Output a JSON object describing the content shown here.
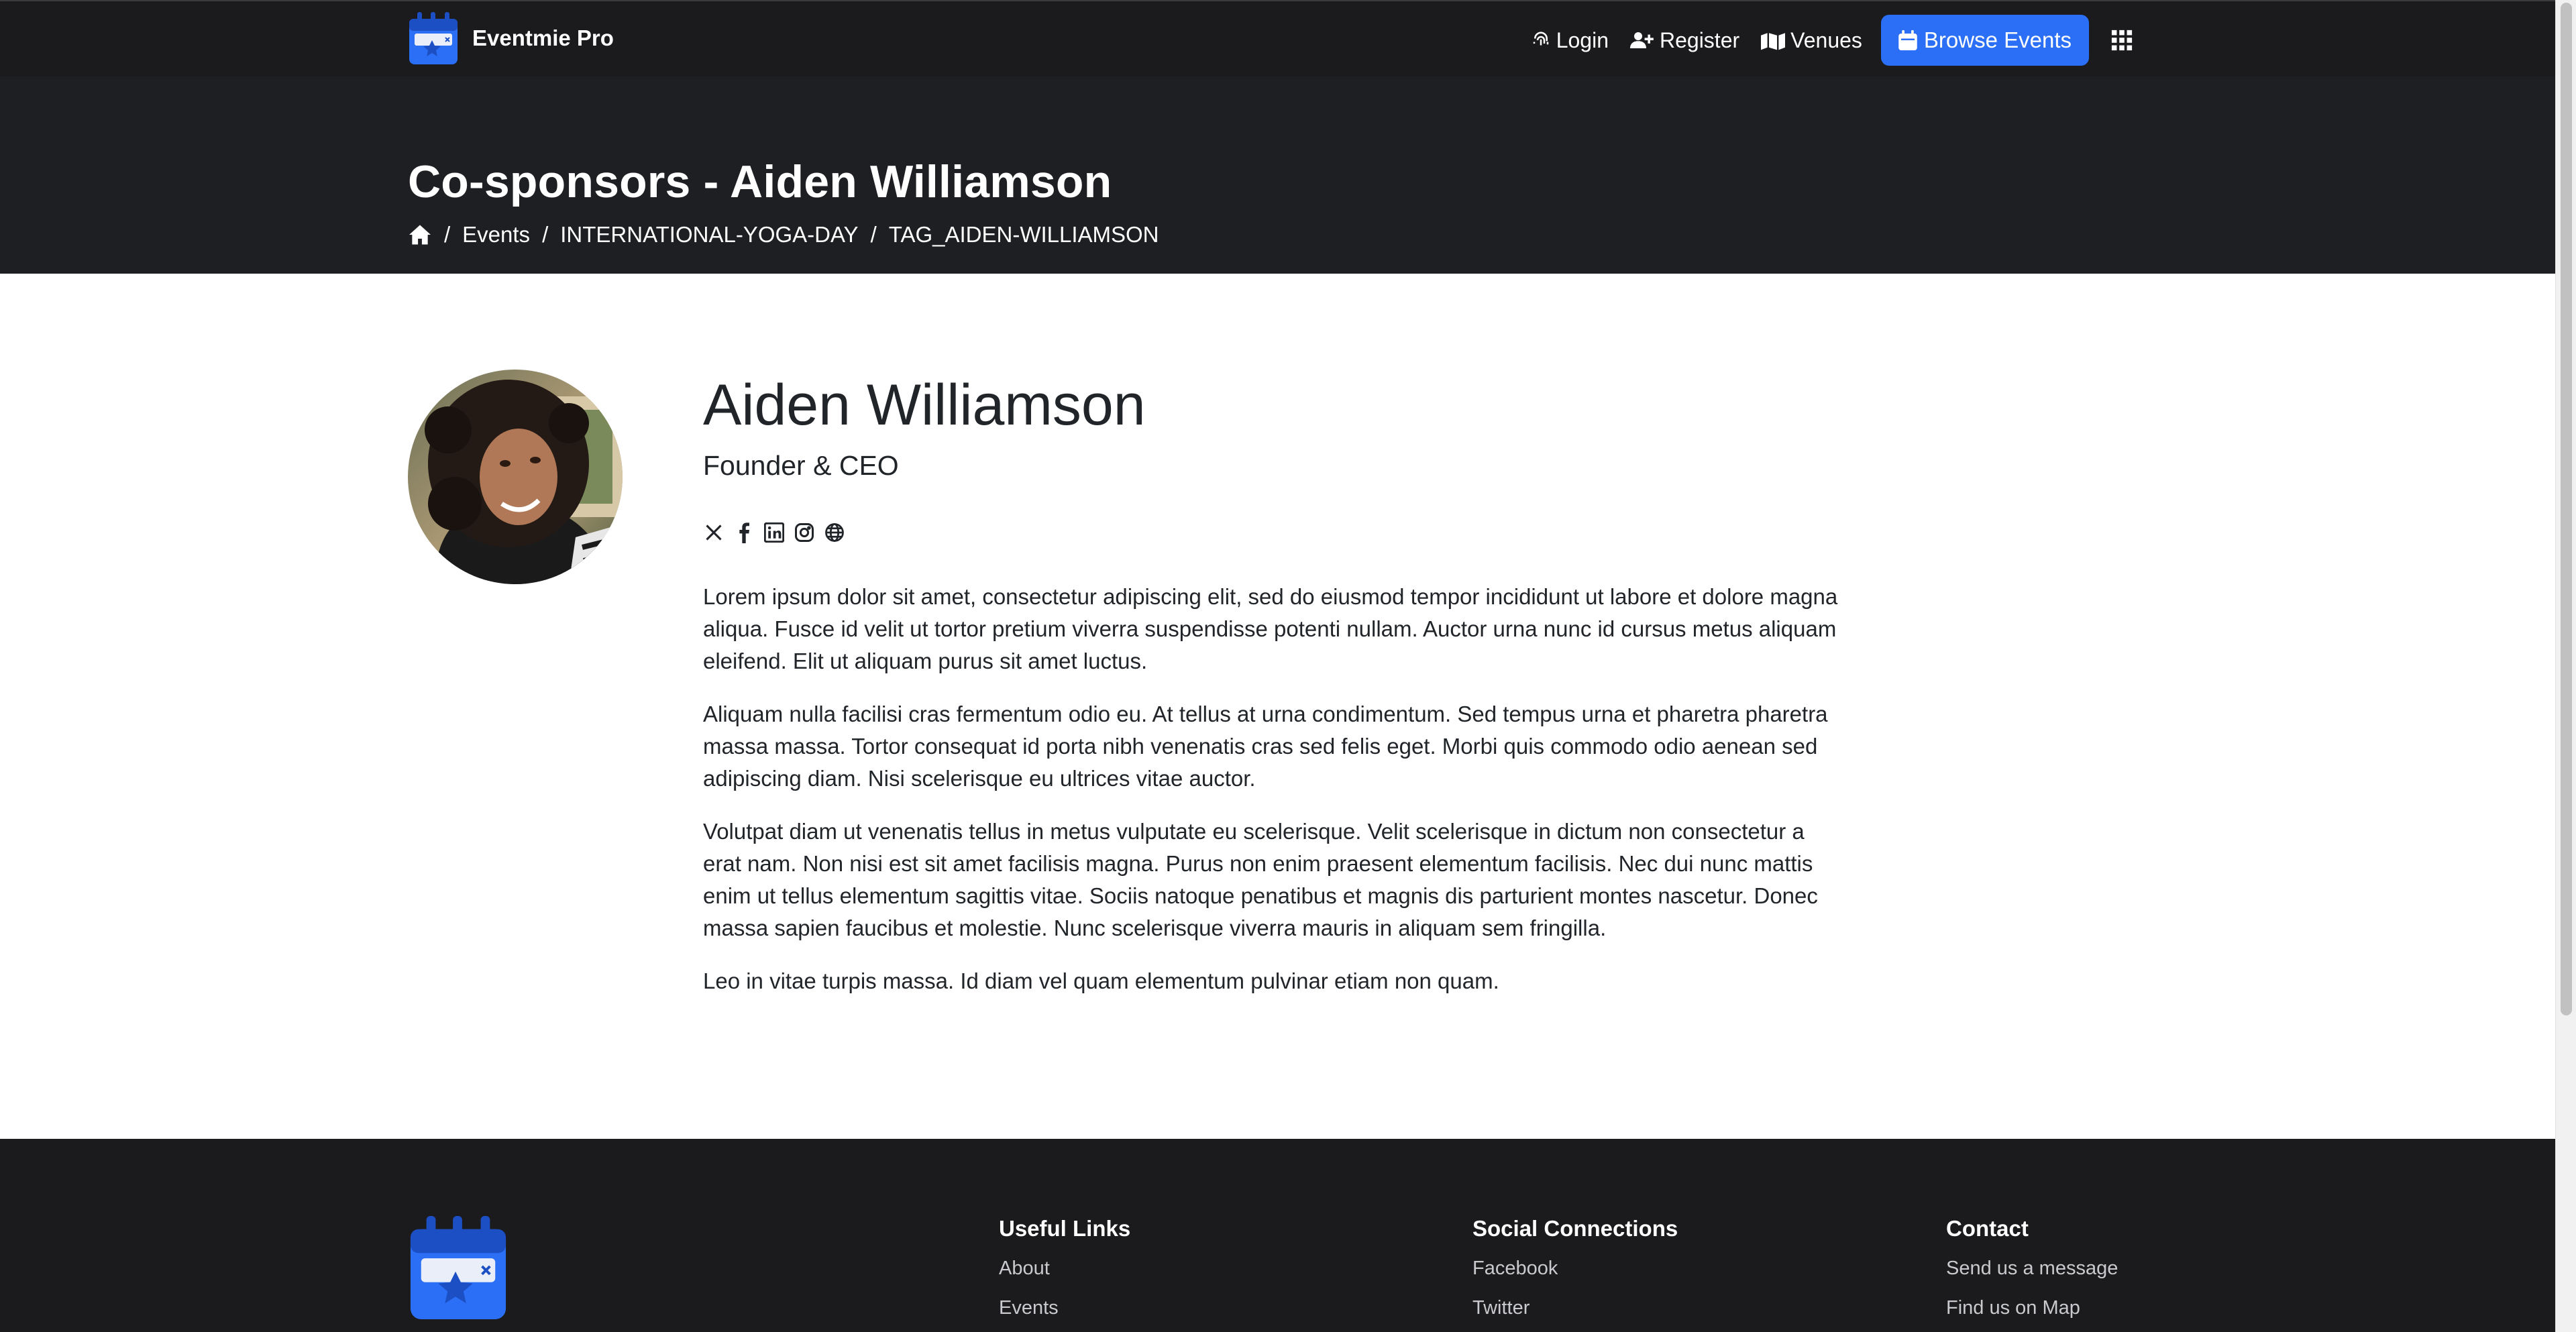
{
  "brand": {
    "name": "Eventmie Pro",
    "logo_icon": "calendar-star-icon"
  },
  "nav": {
    "login": "Login",
    "register": "Register",
    "venues": "Venues",
    "browse_events": "Browse Events",
    "apps_icon": "grid-icon"
  },
  "hero": {
    "title": "Co-sponsors - Aiden Williamson",
    "breadcrumb": [
      "Events",
      "INTERNATIONAL-YOGA-DAY",
      "TAG_AIDEN-WILLIAMSON"
    ],
    "separator": "/"
  },
  "profile": {
    "name": "Aiden Williamson",
    "designation": "Founder & CEO",
    "socials": [
      "x-icon",
      "facebook-icon",
      "linkedin-icon",
      "instagram-icon",
      "globe-icon"
    ],
    "bio": [
      "Lorem ipsum dolor sit amet, consectetur adipiscing elit, sed do eiusmod tempor incididunt ut labore et dolore magna aliqua. Fusce id velit ut tortor pretium viverra suspendisse potenti nullam. Auctor urna nunc id cursus metus aliquam eleifend. Elit ut aliquam purus sit amet luctus.",
      "Aliquam nulla facilisi cras fermentum odio eu. At tellus at urna condimentum. Sed tempus urna et pharetra pharetra massa massa. Tortor consequat id porta nibh venenatis cras sed felis eget. Morbi quis commodo odio aenean sed adipiscing diam. Nisi scelerisque eu ultrices vitae auctor.",
      "Volutpat diam ut venenatis tellus in metus vulputate eu scelerisque. Velit scelerisque in dictum non consectetur a erat nam. Non nisi est sit amet facilisis magna. Purus non enim praesent elementum facilisis. Nec dui nunc mattis enim ut tellus elementum sagittis vitae. Sociis natoque penatibus et magnis dis parturient montes nascetur. Donec massa sapien faucibus et molestie. Nunc scelerisque viverra mauris in aliquam sem fringilla.",
      "Leo in vitae turpis massa. Id diam vel quam elementum pulvinar etiam non quam."
    ]
  },
  "footer": {
    "useful_links": {
      "title": "Useful Links",
      "items": [
        "About",
        "Events"
      ]
    },
    "social": {
      "title": "Social Connections",
      "items": [
        "Facebook",
        "Twitter"
      ]
    },
    "contact": {
      "title": "Contact",
      "items": [
        "Send us a message",
        "Find us on Map"
      ]
    }
  },
  "colors": {
    "accent": "#2b6ff6",
    "navbar_bg": "#1b1b1d",
    "hero_bg": "#1e1f22",
    "footer_bg": "#1b1b1d"
  }
}
